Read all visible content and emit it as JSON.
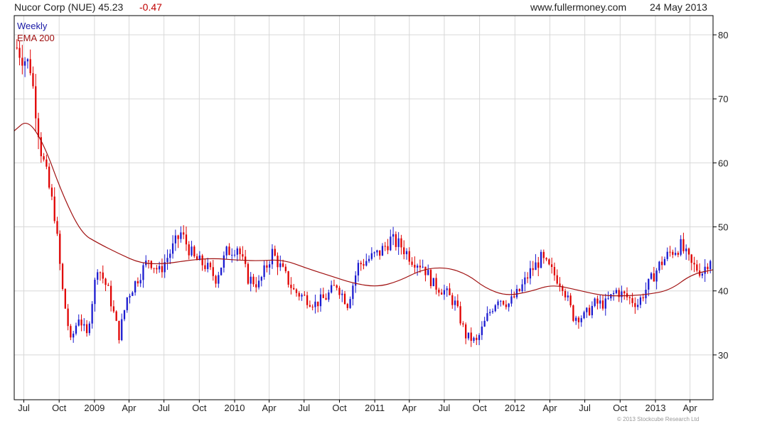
{
  "header": {
    "title": "Nucor Corp (NUE) 45.23",
    "change": "-0.47",
    "website": "www.fullermoney.com",
    "date": "24 May 2013"
  },
  "legend": {
    "interval": "Weekly",
    "indicator": "EMA 200"
  },
  "copyright": "© 2013 Stockcube Research Ltd",
  "colors": {
    "up_candle": "#1a1ad0",
    "down_candle": "#e00000",
    "ema_line": "#a01010",
    "grid": "#d8d8d8"
  },
  "chart_data": {
    "type": "candlestick",
    "grid": true,
    "y_axis_position": "right",
    "ylim": [
      23,
      83
    ],
    "y_ticks": [
      30,
      40,
      50,
      60,
      70,
      80
    ],
    "x_tick_labels": [
      "Jul",
      "Oct",
      "2009",
      "Apr",
      "Jul",
      "Oct",
      "2010",
      "Apr",
      "Jul",
      "Oct",
      "2011",
      "Apr",
      "Jul",
      "Oct",
      "2012",
      "Apr",
      "Jul",
      "Oct",
      "2013",
      "Apr"
    ],
    "x_tick_dates": [
      "2008-07-01",
      "2008-10-01",
      "2009-01-01",
      "2009-04-01",
      "2009-07-01",
      "2009-10-01",
      "2010-01-01",
      "2010-04-01",
      "2010-07-01",
      "2010-10-01",
      "2011-01-01",
      "2011-04-01",
      "2011-07-01",
      "2011-10-01",
      "2012-01-01",
      "2012-04-01",
      "2012-07-01",
      "2012-10-01",
      "2013-01-01",
      "2013-04-01"
    ],
    "x_range": [
      "2008-06-06",
      "2013-05-31"
    ],
    "series": [
      {
        "name": "Weekly",
        "dates": [
          "2008-06-13",
          "2008-07-18",
          "2008-08-15",
          "2008-09-19",
          "2008-10-10",
          "2008-10-31",
          "2008-11-21",
          "2008-12-12",
          "2009-01-09",
          "2009-02-06",
          "2009-03-06",
          "2009-03-27",
          "2009-04-24",
          "2009-05-22",
          "2009-06-19",
          "2009-07-17",
          "2009-08-14",
          "2009-09-18",
          "2009-10-16",
          "2009-11-13",
          "2009-12-11",
          "2010-01-08",
          "2010-02-05",
          "2010-03-05",
          "2010-04-09",
          "2010-05-07",
          "2010-06-04",
          "2010-07-02",
          "2010-07-30",
          "2010-08-27",
          "2010-09-24",
          "2010-10-22",
          "2010-11-19",
          "2010-12-17",
          "2011-01-14",
          "2011-02-11",
          "2011-03-11",
          "2011-04-08",
          "2011-05-06",
          "2011-06-03",
          "2011-07-01",
          "2011-07-29",
          "2011-08-26",
          "2011-09-23",
          "2011-10-21",
          "2011-11-18",
          "2011-12-16",
          "2012-01-13",
          "2012-02-10",
          "2012-03-09",
          "2012-04-06",
          "2012-05-04",
          "2012-06-01",
          "2012-06-29",
          "2012-07-27",
          "2012-08-24",
          "2012-09-21",
          "2012-10-19",
          "2012-11-16",
          "2012-12-14",
          "2013-01-11",
          "2013-02-08",
          "2013-03-08",
          "2013-04-05",
          "2013-05-03",
          "2013-05-24"
        ],
        "close": [
          78,
          75,
          62,
          52,
          40,
          32,
          36,
          33,
          44,
          40,
          33,
          39,
          42,
          45,
          43,
          46,
          49,
          45,
          44,
          42,
          46,
          47,
          42,
          41,
          46,
          43,
          40,
          39,
          38,
          39,
          41,
          38,
          44,
          45,
          46,
          48,
          47,
          45,
          44,
          41,
          40,
          38,
          33,
          32,
          36,
          39,
          38,
          40,
          43,
          45,
          43,
          41,
          36,
          36,
          38,
          38,
          40,
          39,
          38,
          41,
          44,
          46,
          47,
          44,
          43,
          45.23
        ]
      },
      {
        "name": "EMA 200",
        "dates": [
          "2008-06-06",
          "2008-07-11",
          "2008-08-22",
          "2008-10-10",
          "2008-11-28",
          "2009-01-09",
          "2009-03-06",
          "2009-05-01",
          "2009-07-03",
          "2009-09-04",
          "2009-11-06",
          "2010-01-08",
          "2010-03-05",
          "2010-05-07",
          "2010-07-09",
          "2010-09-10",
          "2010-11-05",
          "2011-01-07",
          "2011-03-04",
          "2011-05-06",
          "2011-07-08",
          "2011-09-02",
          "2011-10-14",
          "2011-12-09",
          "2012-02-10",
          "2012-04-06",
          "2012-06-08",
          "2012-08-10",
          "2012-10-05",
          "2012-12-07",
          "2013-02-08",
          "2013-04-05",
          "2013-05-31"
        ],
        "values": [
          65,
          66.8,
          63,
          55,
          49,
          47.5,
          45.8,
          44.3,
          44.2,
          44.8,
          45.1,
          44.8,
          44.7,
          44.9,
          43.5,
          42.3,
          41.2,
          40.6,
          41.5,
          43.4,
          43.7,
          42.5,
          40.5,
          39.2,
          39.9,
          41,
          40.2,
          39.3,
          39.2,
          39.4,
          40.1,
          42.6,
          43.3
        ]
      }
    ]
  }
}
